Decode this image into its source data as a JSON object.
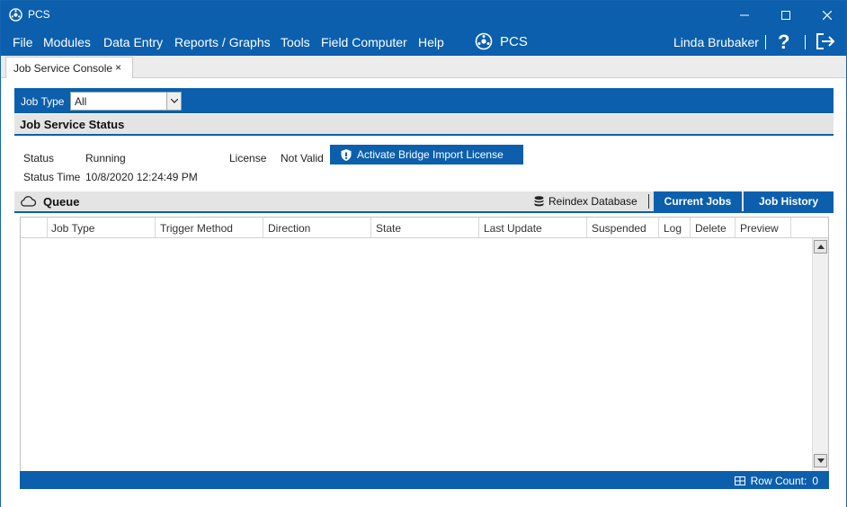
{
  "window": {
    "title": "PCS"
  },
  "menu": {
    "items": [
      "File",
      "Modules",
      "Data Entry",
      "Reports / Graphs",
      "Tools",
      "Field Computer",
      "Help"
    ],
    "brand": "PCS",
    "user": "Linda Brubaker",
    "help_glyph": "?"
  },
  "tabs": [
    {
      "label": "Job Service Console",
      "close": "×"
    }
  ],
  "job_type": {
    "label": "Job Type",
    "value": "All"
  },
  "status_section": {
    "title": "Job Service Status",
    "status_label": "Status",
    "status_value": "Running",
    "time_label": "Status Time",
    "time_value": "10/8/2020 12:24:49 PM",
    "license_label": "License",
    "license_value": "Not Valid",
    "activate_button": "Activate Bridge Import License"
  },
  "queue": {
    "title": "Queue",
    "reindex": "Reindex Database",
    "tab_current": "Current Jobs",
    "tab_history": "Job History",
    "columns": [
      "",
      "Job Type",
      "Trigger Method",
      "Direction",
      "State",
      "Last Update",
      "Suspended",
      "Log",
      "Delete",
      "Preview"
    ],
    "row_count_label": "Row Count:",
    "row_count": "0"
  },
  "colors": {
    "accent": "#0b5fad",
    "section_bg": "#e4e4e4"
  },
  "icons": [
    "pcs-logo-icon",
    "minimize-icon",
    "maximize-icon",
    "close-icon",
    "help-icon",
    "logout-icon",
    "shield-icon",
    "cloud-icon",
    "database-icon",
    "grid-icon",
    "scroll-up-icon",
    "scroll-down-icon",
    "dropdown-arrow-icon"
  ]
}
